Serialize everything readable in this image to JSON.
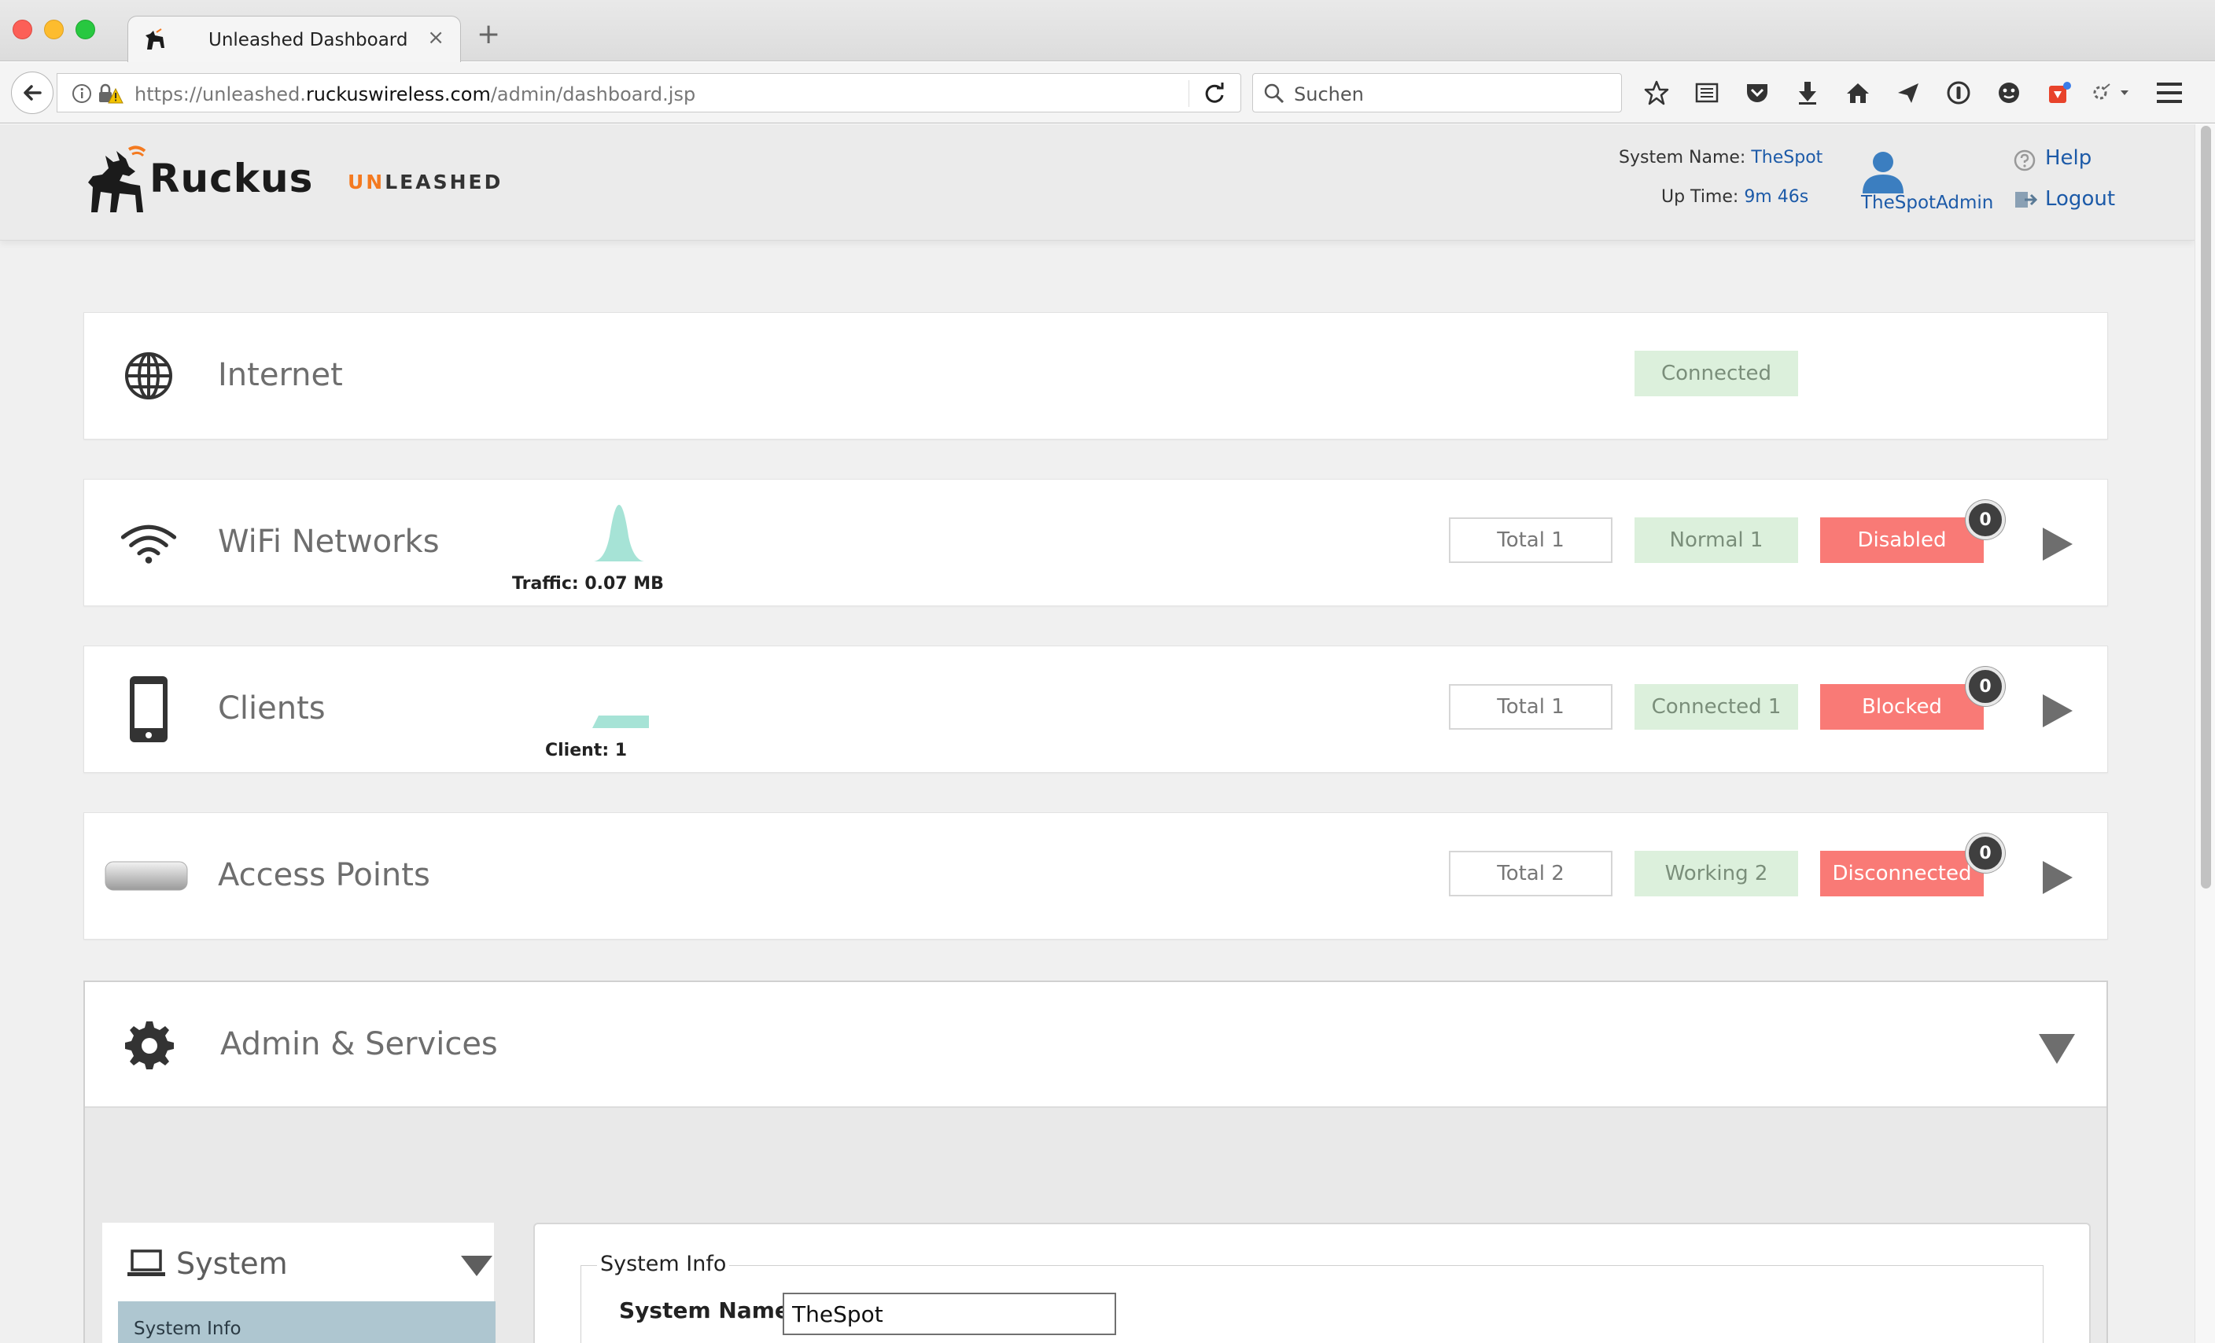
{
  "browser": {
    "tab_title": "Unleashed Dashboard",
    "tab_close": "×",
    "new_tab": "+",
    "url_prefix": "https://unleashed.",
    "url_host": "ruckuswireless.com",
    "url_path": "/admin/dashboard.jsp",
    "search_placeholder": "Suchen"
  },
  "header": {
    "logo_text": "Ruckus",
    "product_un": "UN",
    "product_rest": "LEASHED",
    "system_name_label": "System Name:",
    "system_name_value": "TheSpot",
    "uptime_label": "Up Time:",
    "uptime_value": "9m 46s",
    "user_name": "TheSpotAdmin",
    "help_label": "Help",
    "logout_label": "Logout"
  },
  "panels": {
    "internet": {
      "title": "Internet",
      "status": "Connected"
    },
    "wifi": {
      "title": "WiFi Networks",
      "chart_label": "Traffic: 0.07 MB",
      "total": "Total 1",
      "normal": "Normal 1",
      "disabled": "Disabled",
      "disabled_count": "0"
    },
    "clients": {
      "title": "Clients",
      "chart_label": "Client: 1",
      "total": "Total 1",
      "connected": "Connected 1",
      "blocked": "Blocked",
      "blocked_count": "0"
    },
    "aps": {
      "title": "Access Points",
      "total": "Total 2",
      "working": "Working 2",
      "disconnected": "Disconnected",
      "disconnected_count": "0"
    },
    "admin": {
      "title": "Admin & Services",
      "sidebar_title": "System",
      "sidebar_item": "System Info",
      "fieldset_legend": "System Info",
      "system_name_label": "System Name*",
      "system_name_value": "TheSpot"
    }
  },
  "colors": {
    "link_blue": "#1c5aa8",
    "ok_green_bg": "#dcf0dc",
    "alert_red": "#f97a76",
    "chart_teal": "#a6e3d6",
    "brand_orange": "#f47a20"
  }
}
